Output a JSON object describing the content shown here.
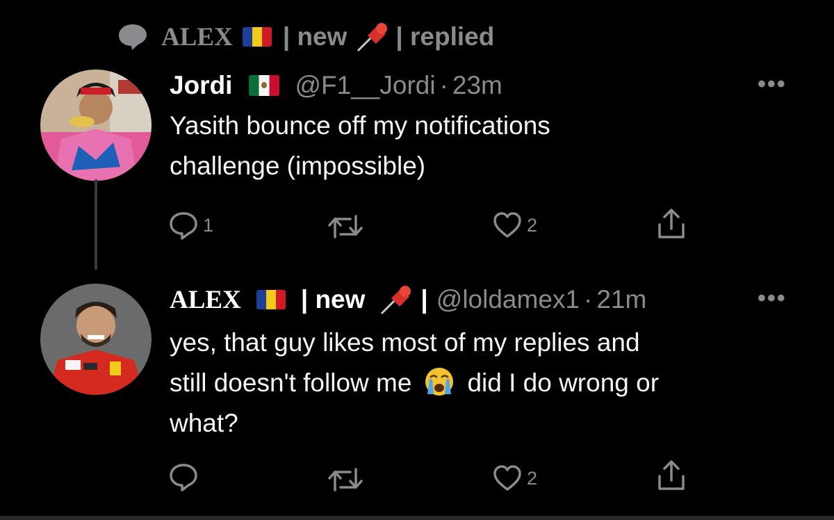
{
  "context": {
    "name": "ALEX",
    "suffix": "| new",
    "tail": "| replied"
  },
  "tweet1": {
    "name": "Jordi",
    "handle": "@F1__Jordi",
    "dot": "·",
    "time": "23m",
    "more": "•••",
    "lines": [
      "Yasith bounce off my notifications",
      "challenge (impossible)"
    ],
    "replies": "1",
    "retweets": "",
    "likes": "2"
  },
  "tweet2": {
    "name": "ALEX",
    "suffix": "| new",
    "bar": "|",
    "handle": "@loldamex1",
    "dot": "·",
    "time": "21m",
    "more": "•••",
    "line1": "yes, that guy likes most of my replies and",
    "line2a": "still doesn't follow me",
    "line2b": "did I do wrong or",
    "line3": "what?",
    "replies": "",
    "retweets": "",
    "likes": "2"
  },
  "icons": {
    "context": "speech-bubble-icon",
    "reply": "reply-icon",
    "retweet": "retweet-icon",
    "like": "heart-icon",
    "share": "share-icon"
  }
}
